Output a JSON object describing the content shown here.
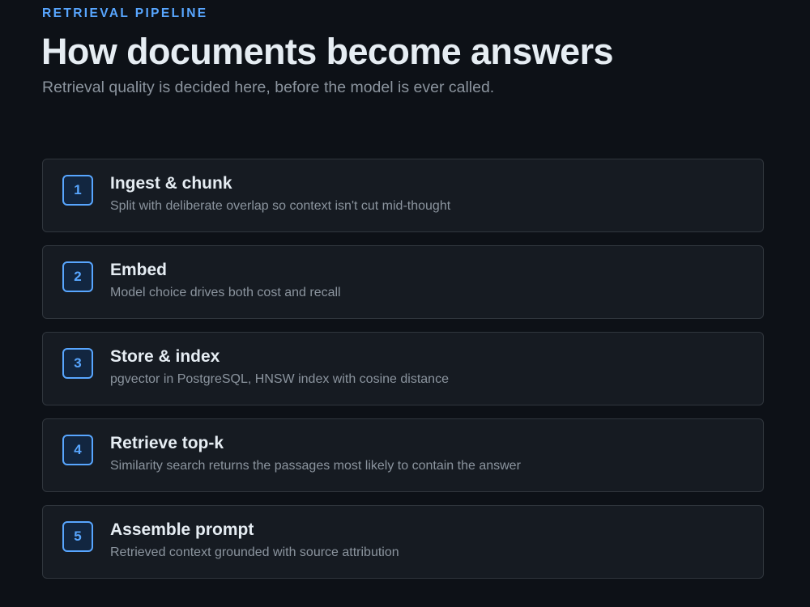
{
  "header": {
    "eyebrow": "RETRIEVAL PIPELINE",
    "title": "How documents become answers",
    "subtitle": "Retrieval quality is decided here, before the model is ever called."
  },
  "steps": [
    {
      "number": "1",
      "title": "Ingest & chunk",
      "description": "Split with deliberate overlap so context isn't cut mid-thought"
    },
    {
      "number": "2",
      "title": "Embed",
      "description": "Model choice drives both cost and recall"
    },
    {
      "number": "3",
      "title": "Store & index",
      "description": "pgvector in PostgreSQL, HNSW index with cosine distance"
    },
    {
      "number": "4",
      "title": "Retrieve top-k",
      "description": "Similarity search returns the passages most likely to contain the answer"
    },
    {
      "number": "5",
      "title": "Assemble prompt",
      "description": "Retrieved context grounded with source attribution"
    }
  ],
  "colors": {
    "background": "#0d1117",
    "card": "#161b22",
    "border": "#30363d",
    "accent": "#58a6ff",
    "text": "#e6edf3",
    "muted": "#8b949e"
  }
}
